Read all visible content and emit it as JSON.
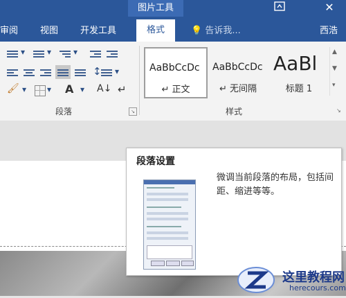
{
  "titlebar": {
    "context_title": "图片工具",
    "window_button_icon": "ribbon-display-options-icon",
    "close_icon": "close-icon",
    "accent": "#2b579a"
  },
  "tabs": [
    {
      "label": "审阅"
    },
    {
      "label": "视图"
    },
    {
      "label": "开发工具"
    },
    {
      "label": "格式",
      "active": true
    },
    {
      "label": "西浩"
    }
  ],
  "tell_me": {
    "label": "告诉我..."
  },
  "ribbon": {
    "paragraph_group": {
      "label": "段落"
    },
    "styles_group": {
      "label": "样式",
      "styles": [
        {
          "sample": "AaBbCcDc",
          "name": "正文",
          "selected": true
        },
        {
          "sample": "AaBbCcDc",
          "name": "无间隔"
        },
        {
          "sample": "AaBl",
          "name": "标题 1"
        }
      ]
    }
  },
  "tooltip": {
    "title": "段落设置",
    "description": "微调当前段落的布局，包括间距、缩进等等。"
  },
  "watermark": {
    "text": "这里教程网",
    "url": "herecours.com"
  }
}
